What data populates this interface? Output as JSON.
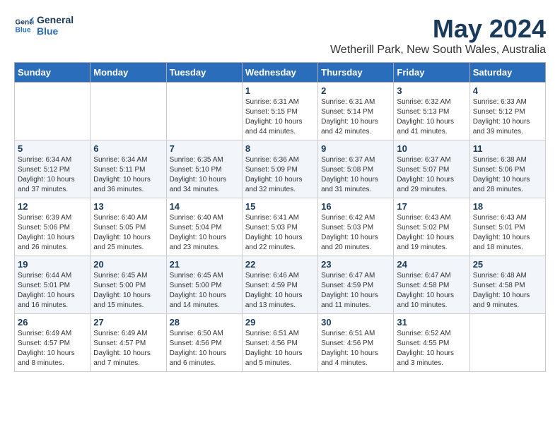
{
  "logo": {
    "line1": "General",
    "line2": "Blue"
  },
  "title": "May 2024",
  "subtitle": "Wetherill Park, New South Wales, Australia",
  "weekdays": [
    "Sunday",
    "Monday",
    "Tuesday",
    "Wednesday",
    "Thursday",
    "Friday",
    "Saturday"
  ],
  "weeks": [
    [
      {
        "day": "",
        "info": ""
      },
      {
        "day": "",
        "info": ""
      },
      {
        "day": "",
        "info": ""
      },
      {
        "day": "1",
        "info": "Sunrise: 6:31 AM\nSunset: 5:15 PM\nDaylight: 10 hours\nand 44 minutes."
      },
      {
        "day": "2",
        "info": "Sunrise: 6:31 AM\nSunset: 5:14 PM\nDaylight: 10 hours\nand 42 minutes."
      },
      {
        "day": "3",
        "info": "Sunrise: 6:32 AM\nSunset: 5:13 PM\nDaylight: 10 hours\nand 41 minutes."
      },
      {
        "day": "4",
        "info": "Sunrise: 6:33 AM\nSunset: 5:12 PM\nDaylight: 10 hours\nand 39 minutes."
      }
    ],
    [
      {
        "day": "5",
        "info": "Sunrise: 6:34 AM\nSunset: 5:12 PM\nDaylight: 10 hours\nand 37 minutes."
      },
      {
        "day": "6",
        "info": "Sunrise: 6:34 AM\nSunset: 5:11 PM\nDaylight: 10 hours\nand 36 minutes."
      },
      {
        "day": "7",
        "info": "Sunrise: 6:35 AM\nSunset: 5:10 PM\nDaylight: 10 hours\nand 34 minutes."
      },
      {
        "day": "8",
        "info": "Sunrise: 6:36 AM\nSunset: 5:09 PM\nDaylight: 10 hours\nand 32 minutes."
      },
      {
        "day": "9",
        "info": "Sunrise: 6:37 AM\nSunset: 5:08 PM\nDaylight: 10 hours\nand 31 minutes."
      },
      {
        "day": "10",
        "info": "Sunrise: 6:37 AM\nSunset: 5:07 PM\nDaylight: 10 hours\nand 29 minutes."
      },
      {
        "day": "11",
        "info": "Sunrise: 6:38 AM\nSunset: 5:06 PM\nDaylight: 10 hours\nand 28 minutes."
      }
    ],
    [
      {
        "day": "12",
        "info": "Sunrise: 6:39 AM\nSunset: 5:06 PM\nDaylight: 10 hours\nand 26 minutes."
      },
      {
        "day": "13",
        "info": "Sunrise: 6:40 AM\nSunset: 5:05 PM\nDaylight: 10 hours\nand 25 minutes."
      },
      {
        "day": "14",
        "info": "Sunrise: 6:40 AM\nSunset: 5:04 PM\nDaylight: 10 hours\nand 23 minutes."
      },
      {
        "day": "15",
        "info": "Sunrise: 6:41 AM\nSunset: 5:03 PM\nDaylight: 10 hours\nand 22 minutes."
      },
      {
        "day": "16",
        "info": "Sunrise: 6:42 AM\nSunset: 5:03 PM\nDaylight: 10 hours\nand 20 minutes."
      },
      {
        "day": "17",
        "info": "Sunrise: 6:43 AM\nSunset: 5:02 PM\nDaylight: 10 hours\nand 19 minutes."
      },
      {
        "day": "18",
        "info": "Sunrise: 6:43 AM\nSunset: 5:01 PM\nDaylight: 10 hours\nand 18 minutes."
      }
    ],
    [
      {
        "day": "19",
        "info": "Sunrise: 6:44 AM\nSunset: 5:01 PM\nDaylight: 10 hours\nand 16 minutes."
      },
      {
        "day": "20",
        "info": "Sunrise: 6:45 AM\nSunset: 5:00 PM\nDaylight: 10 hours\nand 15 minutes."
      },
      {
        "day": "21",
        "info": "Sunrise: 6:45 AM\nSunset: 5:00 PM\nDaylight: 10 hours\nand 14 minutes."
      },
      {
        "day": "22",
        "info": "Sunrise: 6:46 AM\nSunset: 4:59 PM\nDaylight: 10 hours\nand 13 minutes."
      },
      {
        "day": "23",
        "info": "Sunrise: 6:47 AM\nSunset: 4:59 PM\nDaylight: 10 hours\nand 11 minutes."
      },
      {
        "day": "24",
        "info": "Sunrise: 6:47 AM\nSunset: 4:58 PM\nDaylight: 10 hours\nand 10 minutes."
      },
      {
        "day": "25",
        "info": "Sunrise: 6:48 AM\nSunset: 4:58 PM\nDaylight: 10 hours\nand 9 minutes."
      }
    ],
    [
      {
        "day": "26",
        "info": "Sunrise: 6:49 AM\nSunset: 4:57 PM\nDaylight: 10 hours\nand 8 minutes."
      },
      {
        "day": "27",
        "info": "Sunrise: 6:49 AM\nSunset: 4:57 PM\nDaylight: 10 hours\nand 7 minutes."
      },
      {
        "day": "28",
        "info": "Sunrise: 6:50 AM\nSunset: 4:56 PM\nDaylight: 10 hours\nand 6 minutes."
      },
      {
        "day": "29",
        "info": "Sunrise: 6:51 AM\nSunset: 4:56 PM\nDaylight: 10 hours\nand 5 minutes."
      },
      {
        "day": "30",
        "info": "Sunrise: 6:51 AM\nSunset: 4:56 PM\nDaylight: 10 hours\nand 4 minutes."
      },
      {
        "day": "31",
        "info": "Sunrise: 6:52 AM\nSunset: 4:55 PM\nDaylight: 10 hours\nand 3 minutes."
      },
      {
        "day": "",
        "info": ""
      }
    ]
  ],
  "accent_color": "#2a6ebb",
  "title_color": "#1a3a5c"
}
